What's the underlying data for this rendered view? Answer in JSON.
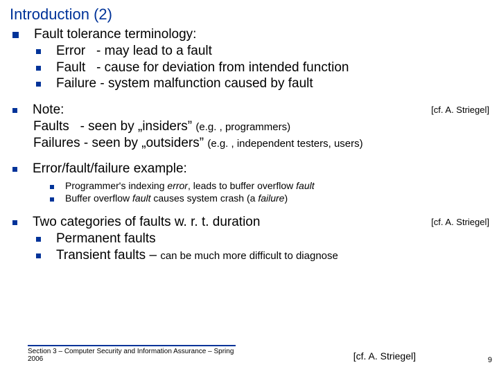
{
  "title": "Introduction (2)",
  "b1": {
    "main": "Fault tolerance terminology:",
    "s1": "Error   - may lead to a fault",
    "s2": "Fault   - cause for deviation from intended function",
    "s3": "Failure - system malfunction caused by fault"
  },
  "b2": {
    "l1": "Note:",
    "cite": "[cf. A. Striegel]",
    "l2a": "Faults   - seen by „insiders” ",
    "l2b": "(e.g. , programmers)",
    "l3a": "Failures - seen by „outsiders” ",
    "l3b": "(e.g. , independent testers, users)"
  },
  "b3": {
    "main": "Error/fault/failure example:",
    "s1a": "Programmer's indexing ",
    "s1b": "error",
    "s1c": ", leads to buffer overflow ",
    "s1d": "fault",
    "s2a": "Buffer overflow ",
    "s2b": "fault",
    "s2c": " causes system crash (a ",
    "s2d": "failure",
    "s2e": ")"
  },
  "b4": {
    "main": "Two categories of faults w. r. t. duration",
    "cite": "[cf. A. Striegel]",
    "s1": "Permanent faults",
    "s2a": "Transient faults – ",
    "s2b": "can be much more difficult to diagnose"
  },
  "footer": {
    "text": "Section 3 – Computer Security and Information Assurance – Spring 2006",
    "cite": "[cf. A. Striegel]",
    "page": "9"
  }
}
